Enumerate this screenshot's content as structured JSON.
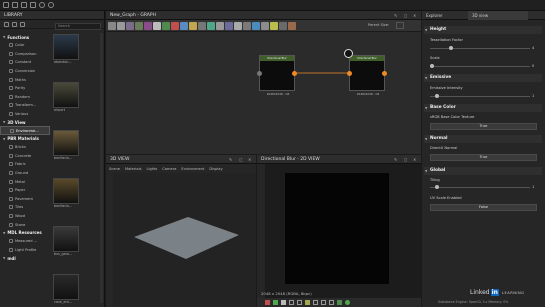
{
  "library": {
    "title": "LIBRARY",
    "search_placeholder": "Search",
    "categories": [
      {
        "label": "Functions",
        "items": [
          "Color",
          "Comparison",
          "Constant",
          "Conversion",
          "Maths",
          "Parity",
          "Random",
          "Transform...",
          "Various"
        ]
      },
      {
        "label": "3D View",
        "items": [
          "Environme..."
        ]
      },
      {
        "label": "PBR Materials",
        "items": [
          "Bricks",
          "Concrete",
          "Fabric",
          "Ground",
          "Metal",
          "Paper",
          "Pavement",
          "Tiles",
          "Wood",
          "Stone"
        ]
      },
      {
        "label": "MDL Resources",
        "items": [
          "Measured ...",
          "Light Profile"
        ]
      },
      {
        "label": "mdl",
        "items": []
      }
    ],
    "thumbnails": [
      "abandon...",
      "airport",
      "bonifacio...",
      "bonifacio...",
      "bus_gara...",
      "cave_ent..."
    ]
  },
  "graph": {
    "title": "New_Graph - GRAPH",
    "parent_size_label": "Parent Size:",
    "nodes": [
      {
        "header": "Directional Blur",
        "caption": "2048x2048 - C8"
      },
      {
        "header": "Directional Blur",
        "caption": "2048x2048 - C8"
      }
    ]
  },
  "view3d": {
    "title": "3D VIEW",
    "menu": [
      "Scene",
      "Materials",
      "Lights",
      "Camera",
      "Environment",
      "Display"
    ]
  },
  "view2d": {
    "title": "Directional Blur - 2D VIEW",
    "info": "2048 x 2048 (RGBA, 8bpc)"
  },
  "right_panel": {
    "tabs": [
      "Explorer",
      "3D view"
    ],
    "sections": {
      "height": "Height",
      "tessellation_label": "Tessellation Factor",
      "tessellation_value": "4",
      "scale_label": "Scale",
      "scale_value": "0",
      "emissive": "Emissive",
      "emissive_intensity_label": "Emissive Intensity",
      "emissive_intensity_value": "1",
      "base_color": "Base Color",
      "srgb_label": "sRGB Base Color Texture",
      "srgb_value": "True",
      "normal": "Normal",
      "directx_label": "DirectX Normal",
      "directx_value": "True",
      "global": "Global",
      "tiling_label": "Tiling",
      "tiling_value": "1",
      "uv_scale_label": "UV Scale Enabled",
      "uv_scale_value": "False"
    },
    "levels": {
      "tessellation": 0.2,
      "scale": 0.0,
      "emissive": 0.05,
      "tiling": 0.05
    }
  },
  "branding": {
    "linkedin": "Linked",
    "in": "in",
    "learning": "LEARNING"
  },
  "status": "Substance Engine: OpenGL 3.x  Memory: 0%",
  "colors": {
    "accent_orange": "#f08a24",
    "node_header": "#3f5e2a",
    "link_blue": "#0a66c2"
  }
}
